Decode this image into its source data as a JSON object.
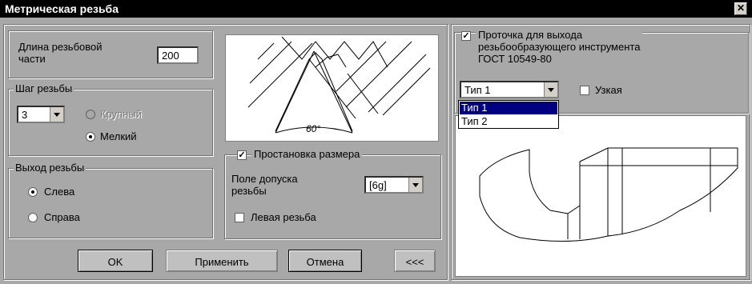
{
  "window": {
    "title": "Метрическая резьба",
    "close_glyph": "✕"
  },
  "length": {
    "label": "Длина резьбовой части",
    "value": "200"
  },
  "pitch": {
    "legend": "Шаг резьбы",
    "value": "3",
    "coarse_label": "Крупный",
    "fine_label": "Мелкий",
    "selected": "Мелкий"
  },
  "exit": {
    "legend": "Выход резьбы",
    "left_label": "Слева",
    "right_label": "Справа",
    "selected": "Слева"
  },
  "diagram": {
    "angle_label": "60°"
  },
  "dimension": {
    "legend": "Простановка размера",
    "checked": true,
    "tolerance_label": "Поле допуска резьбы",
    "tolerance_value": "[6g]",
    "left_thread_label": "Левая резьба",
    "left_thread_checked": false
  },
  "buttons": {
    "ok": "OK",
    "apply": "Применить",
    "cancel": "Отмена",
    "collapse": "<<<"
  },
  "groove": {
    "legend_line1": "Проточка для выхода",
    "legend_line2": "резьбообразующего инструмента",
    "legend_line3": "ГОСТ 10549-80",
    "checked": true,
    "type_value": "Тип 1",
    "type_options": [
      "Тип 1",
      "Тип 2"
    ],
    "narrow_label": "Узкая",
    "narrow_checked": false
  },
  "colors": {
    "dialog_bg": "#a8a8a8",
    "title_bg": "#000000",
    "selection": "#000080"
  }
}
